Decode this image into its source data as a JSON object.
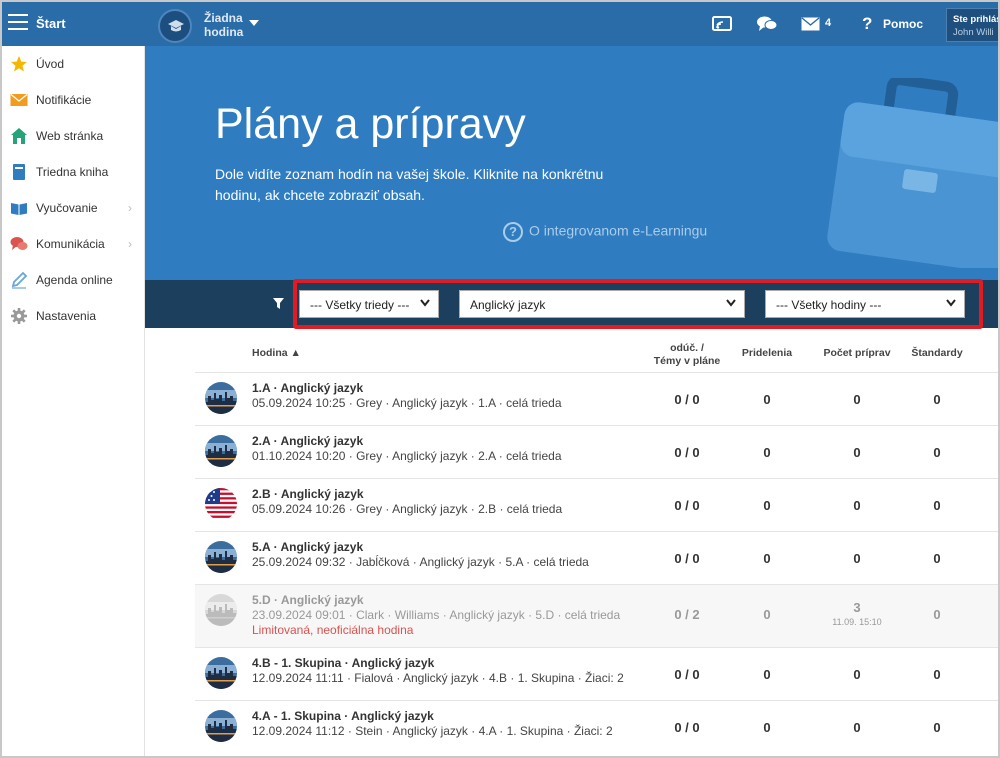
{
  "topbar": {
    "start_label": "Štart",
    "hodina_label": "Žiadna hodina",
    "hodina_line1": "Žiadna",
    "hodina_line2": "hodina",
    "mail_count": "4",
    "help_label": "Pomoc",
    "user_line1": "Ste prihlás",
    "user_line2": "John Willi"
  },
  "sidebar": {
    "items": [
      {
        "label": "Úvod",
        "icon": "star-icon"
      },
      {
        "label": "Notifikácie",
        "icon": "envelope-icon"
      },
      {
        "label": "Web stránka",
        "icon": "home-icon"
      },
      {
        "label": "Triedna kniha",
        "icon": "book-icon"
      },
      {
        "label": "Vyučovanie",
        "icon": "open-book-icon"
      },
      {
        "label": "Komunikácia",
        "icon": "chat-icon"
      },
      {
        "label": "Agenda online",
        "icon": "pencil-icon"
      },
      {
        "label": "Nastavenia",
        "icon": "gear-icon"
      }
    ]
  },
  "hero": {
    "title": "Plány a prípravy",
    "description": "Dole vidíte zoznam hodín na vašej škole. Kliknite na konkrétnu hodinu, ak chcete zobraziť obsah.",
    "link": "O integrovanom e-Learningu"
  },
  "filters": {
    "class": "--- Všetky triedy ---",
    "subject": "Anglický jazyk",
    "lesson": "--- Všetky hodiny ---"
  },
  "table": {
    "headers": {
      "hodina": "Hodina ▲",
      "taught_1": "odúč. /",
      "taught_2": "Témy v pláne",
      "assigned": "Pridelenia",
      "preps": "Počet príprav",
      "standards": "Štandardy"
    },
    "rows": [
      {
        "title": "1.A · Anglický jazyk",
        "sub": "05.09.2024 10:25 · Grey · Anglický jazyk · 1.A · celá trieda",
        "taught": "0 / 0",
        "assigned": "0",
        "preps": "0",
        "standards": "0"
      },
      {
        "title": "2.A · Anglický jazyk",
        "sub": "01.10.2024 10:20 · Grey · Anglický jazyk · 2.A · celá trieda",
        "taught": "0 / 0",
        "assigned": "0",
        "preps": "0",
        "standards": "0"
      },
      {
        "title": "2.B · Anglický jazyk",
        "sub": "05.09.2024 10:26 · Grey · Anglický jazyk · 2.B · celá trieda",
        "taught": "0 / 0",
        "assigned": "0",
        "preps": "0",
        "standards": "0"
      },
      {
        "title": "5.A · Anglický jazyk",
        "sub": "25.09.2024 09:32 · Jabĺčková · Anglický jazyk · 5.A · celá trieda",
        "taught": "0 / 0",
        "assigned": "0",
        "preps": "0",
        "standards": "0"
      },
      {
        "title": "5.D · Anglický jazyk",
        "sub": "23.09.2024 09:01 · Clark · Williams · Anglický jazyk · 5.D · celá trieda",
        "warn": "Limitovaná, neoficiálna hodina",
        "taught": "0 / 2",
        "assigned": "0",
        "preps": "3",
        "preps_ts": "11.09. 15:10",
        "standards": "0"
      },
      {
        "title": "4.B - 1. Skupina · Anglický jazyk",
        "sub": "12.09.2024 11:11 · Fialová · Anglický jazyk · 4.B · 1. Skupina · Žiaci: 2",
        "taught": "0 / 0",
        "assigned": "0",
        "preps": "0",
        "standards": "0"
      },
      {
        "title": "4.A - 1. Skupina · Anglický jazyk",
        "sub": "12.09.2024 11:12 · Stein · Anglický jazyk · 4.A · 1. Skupina · Žiaci: 2",
        "taught": "0 / 0",
        "assigned": "0",
        "preps": "0",
        "standards": "0"
      }
    ]
  },
  "colors": {
    "topbar": "#2a6ca8",
    "hero": "#2f7cc0",
    "filterbar": "#1c3f5e",
    "highlight": "#e01b22",
    "warning": "#d9534f"
  }
}
